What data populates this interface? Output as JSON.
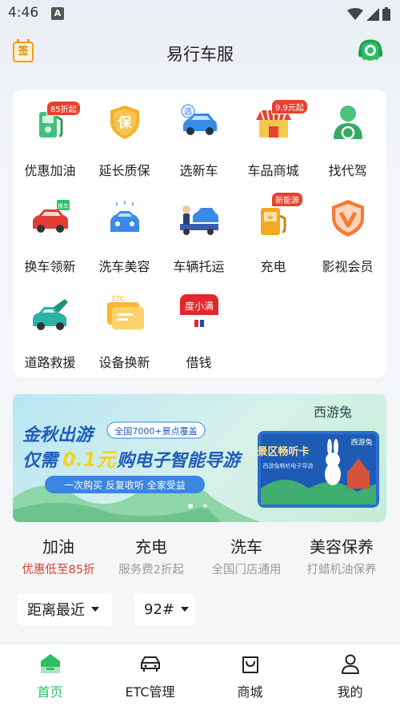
{
  "status": {
    "time": "4:46",
    "a_icon": "A"
  },
  "header": {
    "title": "易行车服",
    "sign_label": "签",
    "left_icon": "sign-in-calendar-icon",
    "right_icon": "customer-service-icon"
  },
  "services": [
    {
      "label": "优惠加油",
      "icon": "fuel-pump-icon",
      "badge": "85折起"
    },
    {
      "label": "延长质保",
      "icon": "shield-icon",
      "icon_text": "保"
    },
    {
      "label": "选新车",
      "icon": "new-car-icon",
      "icon_text": "选"
    },
    {
      "label": "车品商城",
      "icon": "shop-icon",
      "badge": "9.9元起"
    },
    {
      "label": "找代驾",
      "icon": "driver-icon"
    },
    {
      "label": "换车领新",
      "icon": "car-swap-icon",
      "icon_text": "换车"
    },
    {
      "label": "洗车美容",
      "icon": "car-wash-icon"
    },
    {
      "label": "车辆托运",
      "icon": "tow-truck-icon"
    },
    {
      "label": "充电",
      "icon": "charging-station-icon",
      "badge": "新能源"
    },
    {
      "label": "影视会员",
      "icon": "video-membership-icon"
    },
    {
      "label": "道路救援",
      "icon": "road-rescue-icon"
    },
    {
      "label": "设备换新",
      "icon": "etc-card-icon",
      "icon_text": "ETC"
    },
    {
      "label": "借钱",
      "icon": "duxiaoman-icon",
      "icon_text": "度小满"
    }
  ],
  "banner": {
    "brand": "西游兔",
    "headline1": "金秋出游",
    "tag": "全国7000+景点覆盖",
    "headline2_pre": "仅需",
    "headline2_price": "0.1元",
    "headline2_post": "购电子智能导游",
    "slogan": "一次购买  反复收听  全家受益",
    "card_title": "景区畅听卡",
    "card_brand": "西游兔",
    "card_sub": "西游兔畅听电子导游"
  },
  "categories": [
    {
      "title": "加油",
      "sub": "优惠低至85折",
      "sub_color": "#e33b2c"
    },
    {
      "title": "充电",
      "sub": "服务费2折起"
    },
    {
      "title": "洗车",
      "sub": "全国门店通用"
    },
    {
      "title": "美容保养",
      "sub": "打蜡机油保养"
    }
  ],
  "filters": {
    "sort": "距离最近",
    "fuel": "92#"
  },
  "tabs": [
    {
      "label": "首页",
      "icon": "home-icon",
      "active": true
    },
    {
      "label": "ETC管理",
      "icon": "car-icon"
    },
    {
      "label": "商城",
      "icon": "shopping-bag-icon"
    },
    {
      "label": "我的",
      "icon": "profile-icon"
    }
  ],
  "colors": {
    "accent": "#2fbe63",
    "badge_red": "#e8412f",
    "orange": "#f59a1b",
    "blue": "#3a8ae8"
  }
}
